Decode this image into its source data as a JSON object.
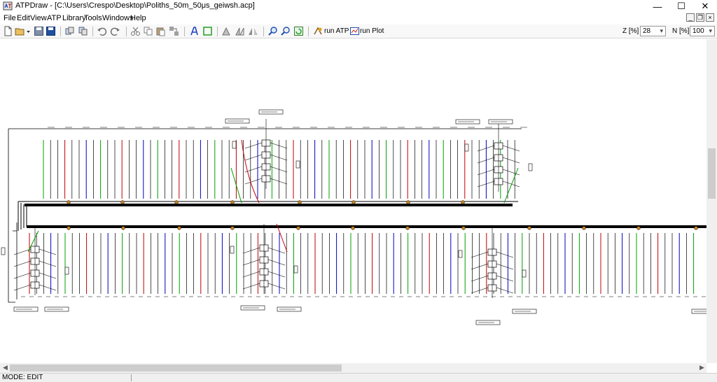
{
  "window": {
    "title": "ATPDraw - [C:\\Users\\Crespo\\Desktop\\Poliths_50m_50μs_geiwsh.acp]",
    "minimize_glyph": "—",
    "maximize_glyph": "☐",
    "close_glyph": "✕"
  },
  "menu": {
    "items": [
      "File",
      "Edit",
      "View",
      "ATP",
      "Library",
      "Tools",
      "Windows",
      "Help"
    ]
  },
  "mdi": {
    "minimize": "_",
    "restore": "❐",
    "close": "×"
  },
  "toolbar": {
    "run_atp_label": "run ATP",
    "run_plot_label": "run Plot",
    "zoom_label": "Z [%]",
    "zoom_value": "28",
    "n_label": "N [%]",
    "n_value": "100"
  },
  "status": {
    "mode": "MODE: EDIT"
  },
  "colors": {
    "background": "#ffffff",
    "wire_black": "#000000",
    "wire_red": "#c00000",
    "wire_green": "#00a000",
    "wire_blue": "#0000c0",
    "node_orange": "#c08020"
  },
  "icons": {
    "app": "atpdraw-app-icon",
    "new": "new-document-icon",
    "open": "open-folder-icon",
    "save": "save-icon",
    "save_as": "save-as-icon",
    "undo": "undo-icon",
    "redo": "redo-icon",
    "cut": "cut-icon",
    "copy": "copy-icon",
    "paste": "paste-icon",
    "text": "text-icon",
    "rectangle": "rectangle-icon",
    "zoom_in": "zoom-in-icon",
    "zoom_out": "zoom-out-icon",
    "refresh": "refresh-icon",
    "run_atp": "run-atp-icon",
    "run_plot": "run-plot-icon"
  }
}
